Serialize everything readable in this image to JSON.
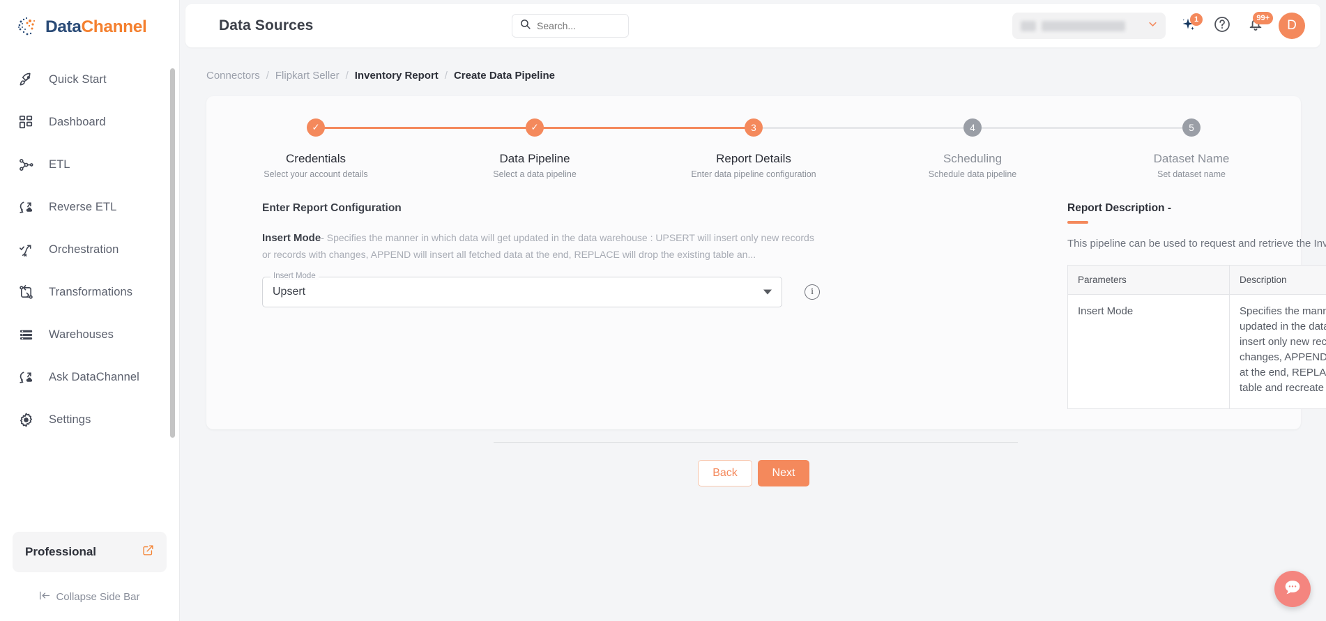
{
  "brand": {
    "name_part1": "Data",
    "name_part2": "Channel",
    "accent": "#f4895c",
    "navy": "#2a4b77"
  },
  "sidebar": {
    "items": [
      {
        "label": "Quick Start",
        "icon": "rocket-icon"
      },
      {
        "label": "Dashboard",
        "icon": "grid-icon"
      },
      {
        "label": "ETL",
        "icon": "etl-icon"
      },
      {
        "label": "Reverse ETL",
        "icon": "reverse-etl-icon"
      },
      {
        "label": "Orchestration",
        "icon": "orchestration-icon"
      },
      {
        "label": "Transformations",
        "icon": "transformations-icon"
      },
      {
        "label": "Warehouses",
        "icon": "warehouse-icon"
      },
      {
        "label": "Ask DataChannel",
        "icon": "ask-datachannel-icon"
      },
      {
        "label": "Settings",
        "icon": "gear-icon"
      }
    ],
    "plan": {
      "label": "Professional",
      "icon": "external-link-icon"
    },
    "collapse": {
      "label": "Collapse Side Bar",
      "icon": "collapse-arrow-icon"
    }
  },
  "topbar": {
    "title": "Data Sources",
    "search": {
      "value": "",
      "placeholder": "Search...",
      "icon": "search-icon"
    },
    "workspace": {
      "value": "",
      "icon": "chevron-down-icon"
    },
    "ai_badge": "1",
    "help_icon": "question-mark-icon",
    "notifications_badge": "99+",
    "avatar_initial": "D"
  },
  "breadcrumb": {
    "items": [
      {
        "label": "Connectors",
        "active": false
      },
      {
        "label": "Flipkart Seller",
        "active": false
      },
      {
        "label": "Inventory Report",
        "active": true
      },
      {
        "label": "Create Data Pipeline",
        "active": true
      }
    ],
    "separator": "/"
  },
  "stepper": {
    "steps": [
      {
        "num": "1",
        "state": "done",
        "glyph": "✓",
        "title": "Credentials",
        "sub": "Select your account details"
      },
      {
        "num": "2",
        "state": "done",
        "glyph": "✓",
        "title": "Data Pipeline",
        "sub": "Select a data pipeline"
      },
      {
        "num": "3",
        "state": "current",
        "glyph": "3",
        "title": "Report Details",
        "sub": "Enter data pipeline configuration"
      },
      {
        "num": "4",
        "state": "todo",
        "glyph": "4",
        "title": "Scheduling",
        "sub": "Schedule data pipeline"
      },
      {
        "num": "5",
        "state": "todo",
        "glyph": "5",
        "title": "Dataset Name",
        "sub": "Set dataset name"
      }
    ]
  },
  "config": {
    "heading": "Enter Report Configuration",
    "field_name": "Insert Mode",
    "field_desc": "- Specifies the manner in which data will get updated in the data warehouse : UPSERT will insert only new records or records with changes, APPEND will insert all fetched data at the end, REPLACE will drop the existing table an...",
    "select_label": "Insert Mode",
    "select_value": "Upsert",
    "info_glyph": "i",
    "back_label": "Back",
    "next_label": "Next"
  },
  "description": {
    "heading": "Report Description -",
    "body": "This pipeline can be used to request and retrieve the Inventory Report",
    "table": {
      "headers": [
        "Parameters",
        "Description"
      ],
      "rows": [
        {
          "parameter": "Insert Mode",
          "description": "Specifies the manner in which data will get updated in the data warehouse : UPSERT will insert only new records or records with changes, APPEND will insert all fetched data at the end, REPLACE will drop the existing table and recreate a fresh one on each run."
        }
      ]
    }
  },
  "chat": {
    "icon": "chat-bubble-icon"
  }
}
